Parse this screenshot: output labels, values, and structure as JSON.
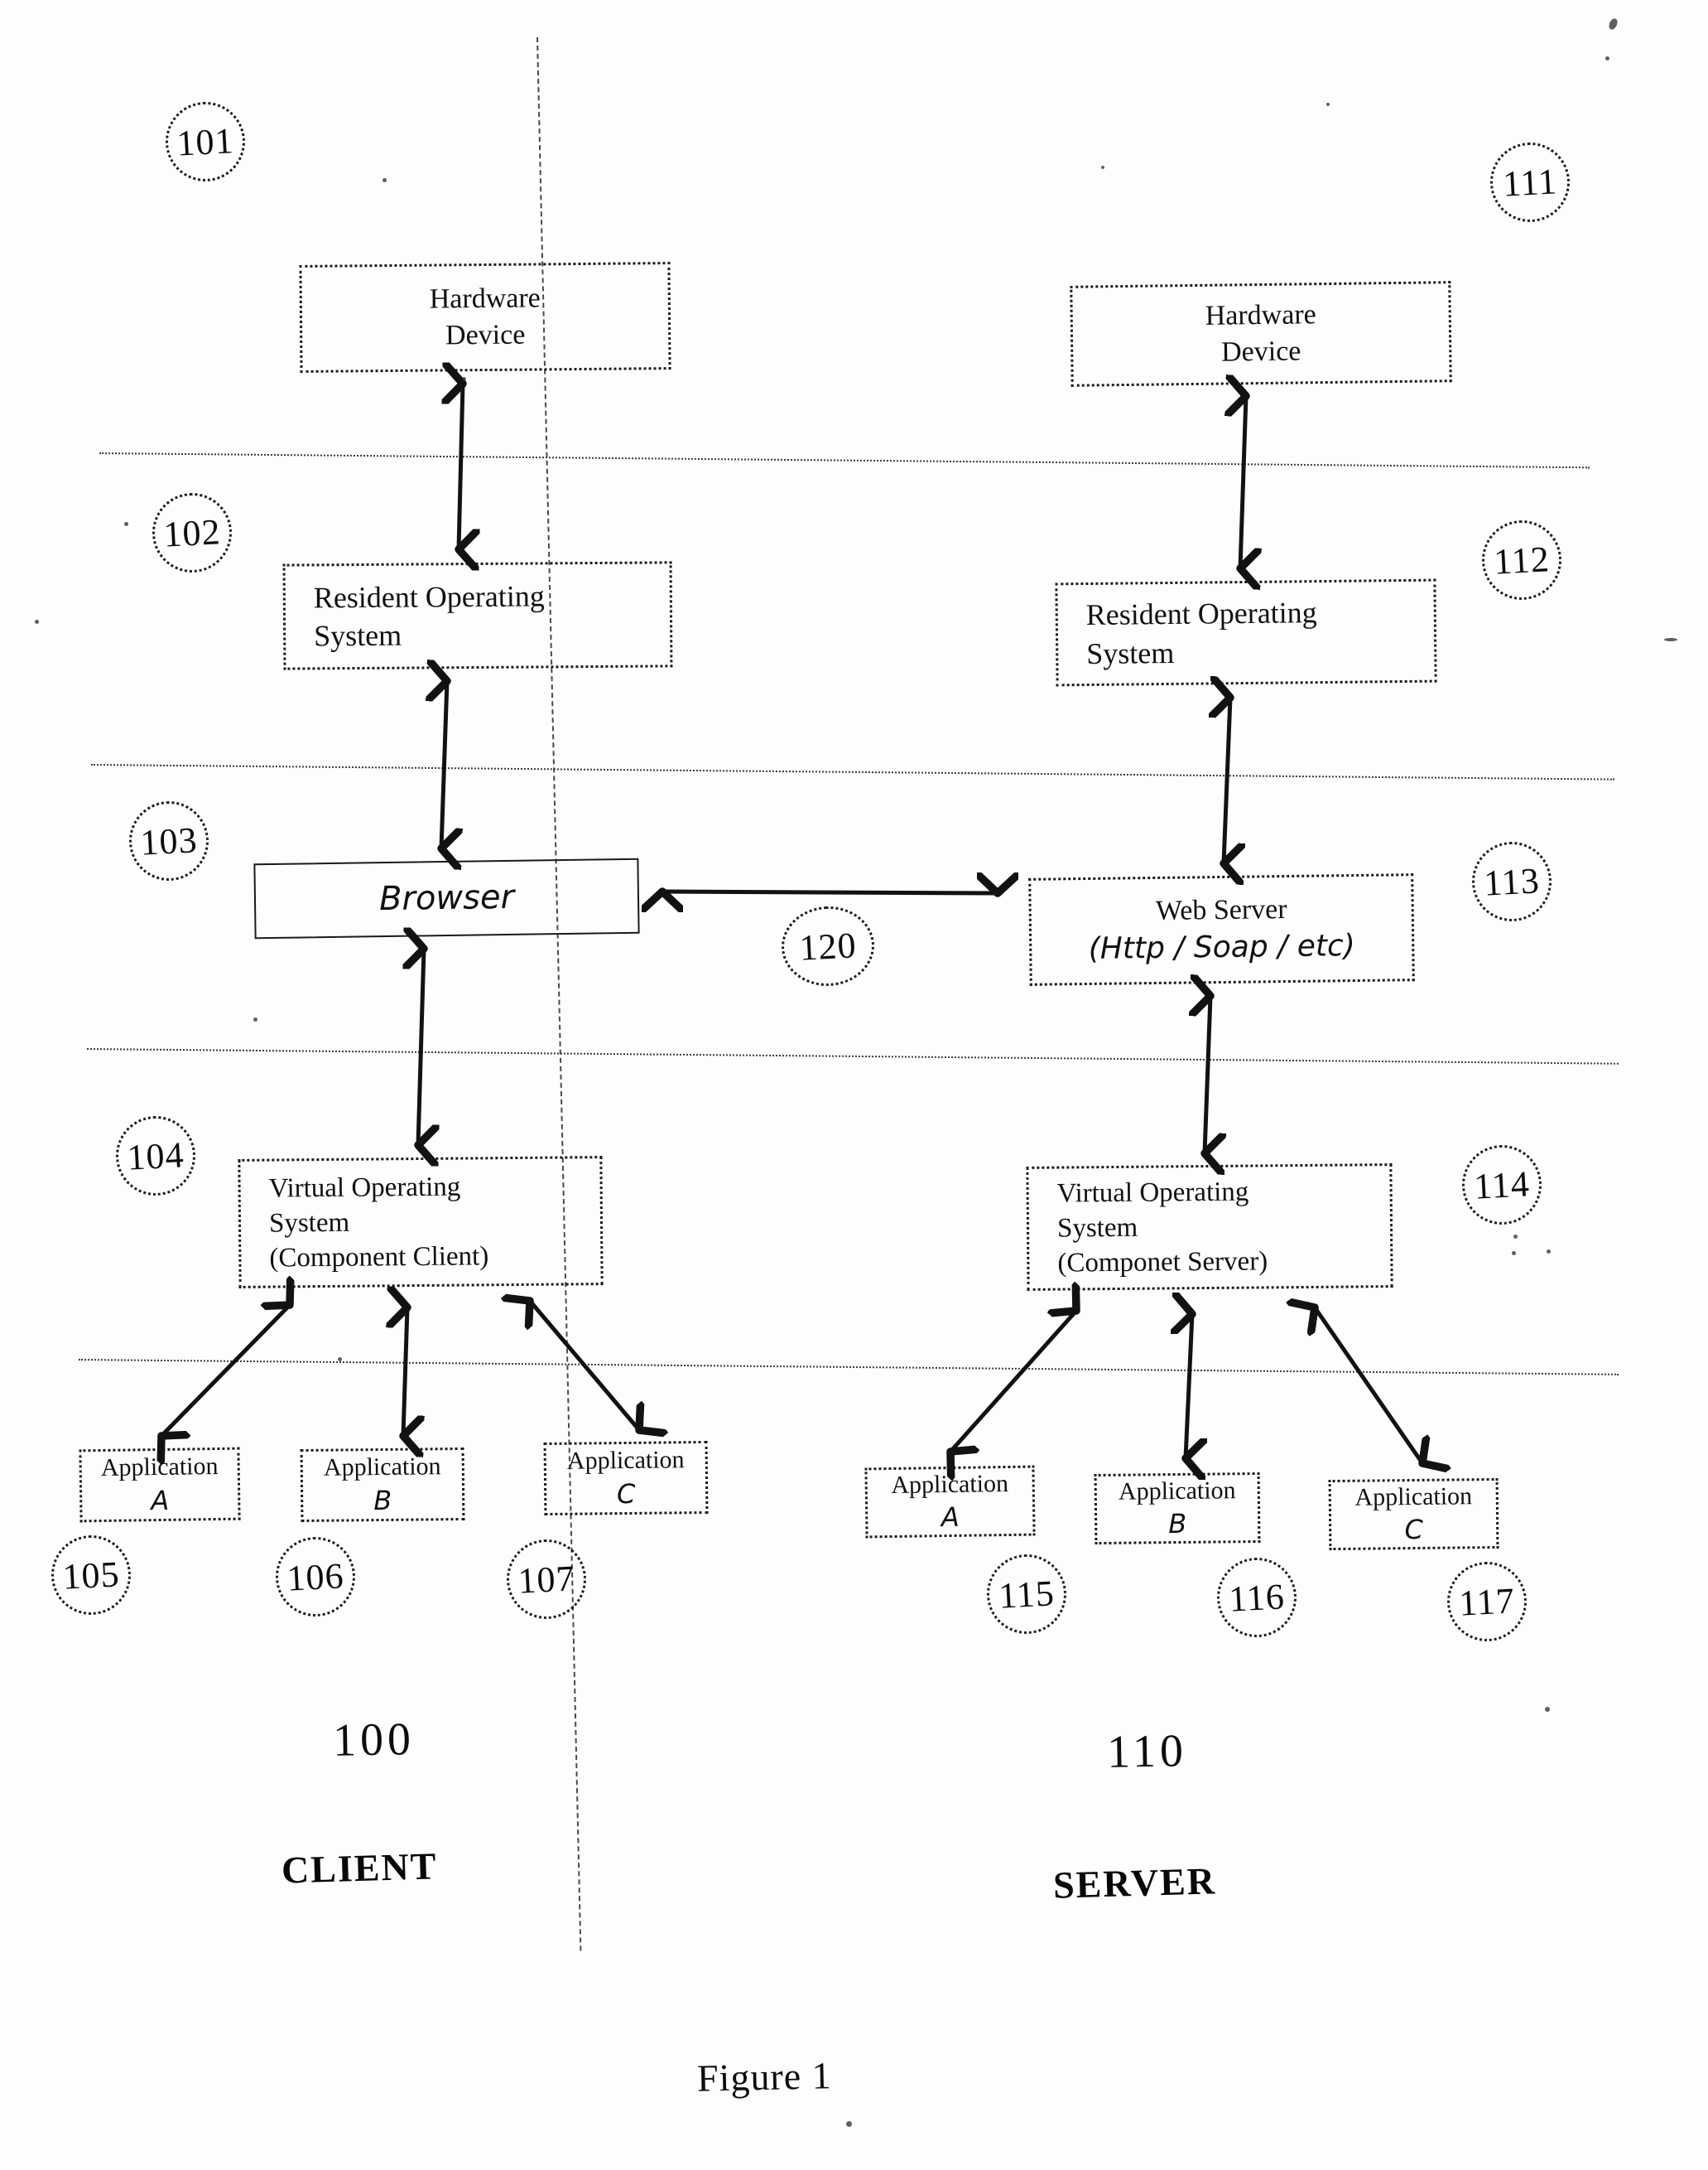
{
  "figure": {
    "caption": "Figure 1"
  },
  "client": {
    "number": "100",
    "caption": "CLIENT",
    "layers": {
      "hardware": {
        "ref": "101",
        "line1": "Hardware",
        "line2": "Device"
      },
      "resident_os": {
        "ref": "102",
        "line1": "Resident Operating",
        "line2": "System"
      },
      "browser": {
        "ref": "103",
        "line1": "Browser"
      },
      "virtual_os": {
        "ref": "104",
        "line1": "Virtual Operating",
        "line2": "System",
        "line3": "(Component Client)"
      }
    },
    "applications": [
      {
        "ref": "105",
        "line1": "Application",
        "letter": "A"
      },
      {
        "ref": "106",
        "line1": "Application",
        "letter": "B"
      },
      {
        "ref": "107",
        "line1": "Application",
        "letter": "C"
      }
    ]
  },
  "server": {
    "number": "110",
    "caption": "SERVER",
    "layers": {
      "hardware": {
        "ref": "111",
        "line1": "Hardware",
        "line2": "Device"
      },
      "resident_os": {
        "ref": "112",
        "line1": "Resident Operating",
        "line2": "System"
      },
      "web_server": {
        "ref": "113",
        "line1": "Web Server",
        "line2": "(Http / Soap / etc)"
      },
      "virtual_os": {
        "ref": "114",
        "line1": "Virtual Operating",
        "line2": "System",
        "line3": "(Componet Server)"
      }
    },
    "applications": [
      {
        "ref": "115",
        "line1": "Application",
        "letter": "A"
      },
      {
        "ref": "116",
        "line1": "Application",
        "letter": "B"
      },
      {
        "ref": "117",
        "line1": "Application",
        "letter": "C"
      }
    ]
  },
  "link": {
    "ref": "120"
  }
}
